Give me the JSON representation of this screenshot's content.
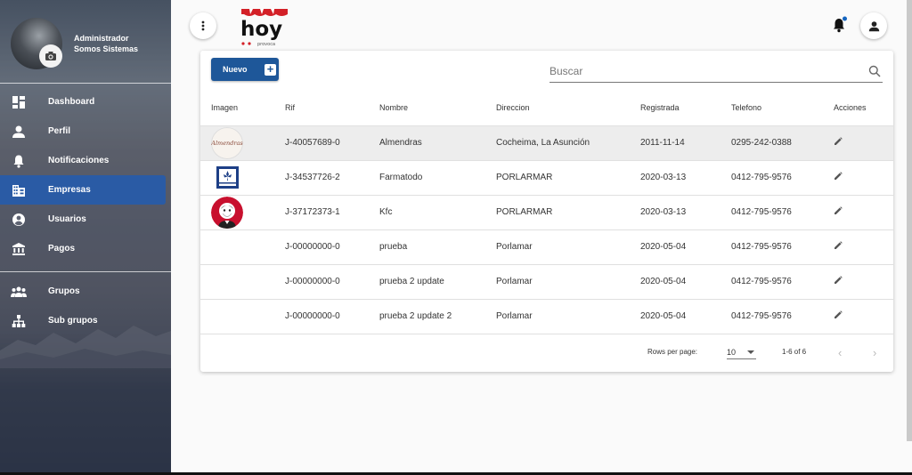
{
  "profile": {
    "line1": "Administrador",
    "line2": "Somos Sistemas"
  },
  "menu": [
    {
      "id": "dashboard",
      "label": "Dashboard",
      "icon": "dashboard-icon"
    },
    {
      "id": "perfil",
      "label": "Perfil",
      "icon": "person-icon"
    },
    {
      "id": "notificaciones",
      "label": "Notificaciones",
      "icon": "bell-icon"
    },
    {
      "id": "empresas",
      "label": "Empresas",
      "icon": "business-icon",
      "active": true
    },
    {
      "id": "usuarios",
      "label": "Usuarios",
      "icon": "account-circle-icon"
    },
    {
      "id": "pagos",
      "label": "Pagos",
      "icon": "bank-icon"
    }
  ],
  "menu2": [
    {
      "id": "grupos",
      "label": "Grupos",
      "icon": "people-icon"
    },
    {
      "id": "subgrupos",
      "label": "Sub grupos",
      "icon": "hierarchy-icon"
    }
  ],
  "brand": {
    "name": "hoy",
    "tagline": "provoca"
  },
  "toolbar": {
    "new_label": "Nuevo",
    "search_placeholder": "Buscar"
  },
  "table": {
    "headers": [
      "Imagen",
      "Rif",
      "Nombre",
      "Direccion",
      "Registrada",
      "Telefono",
      "Acciones"
    ],
    "rows": [
      {
        "rif": "J-40057689-0",
        "nombre": "Almendras",
        "direccion": "Cocheima, La Asunción",
        "registrada": "2011-11-14",
        "telefono": "0295-242-0388",
        "image": "almendras-logo"
      },
      {
        "rif": "J-34537726-2",
        "nombre": "Farmatodo",
        "direccion": "PORLARMAR",
        "registrada": "2020-03-13",
        "telefono": "0412-795-9576",
        "image": "farmatodo-logo"
      },
      {
        "rif": "J-37172373-1",
        "nombre": "Kfc",
        "direccion": "PORLARMAR",
        "registrada": "2020-03-13",
        "telefono": "0412-795-9576",
        "image": "kfc-logo"
      },
      {
        "rif": "J-00000000-0",
        "nombre": "prueba",
        "direccion": "Porlamar",
        "registrada": "2020-05-04",
        "telefono": "0412-795-9576",
        "image": ""
      },
      {
        "rif": "J-00000000-0",
        "nombre": "prueba 2 update",
        "direccion": "Porlamar",
        "registrada": "2020-05-04",
        "telefono": "0412-795-9576",
        "image": ""
      },
      {
        "rif": "J-00000000-0",
        "nombre": "prueba 2 update 2",
        "direccion": "Porlamar",
        "registrada": "2020-05-04",
        "telefono": "0412-795-9576",
        "image": ""
      }
    ]
  },
  "pagination": {
    "rows_per_page_label": "Rows per page:",
    "rows_per_page": "10",
    "range": "1-6 of 6"
  },
  "colors": {
    "primary": "#1e5799",
    "active_menu": "#2a5ba5",
    "notification_dot": "#1565c0",
    "logo_red": "#d32027"
  }
}
